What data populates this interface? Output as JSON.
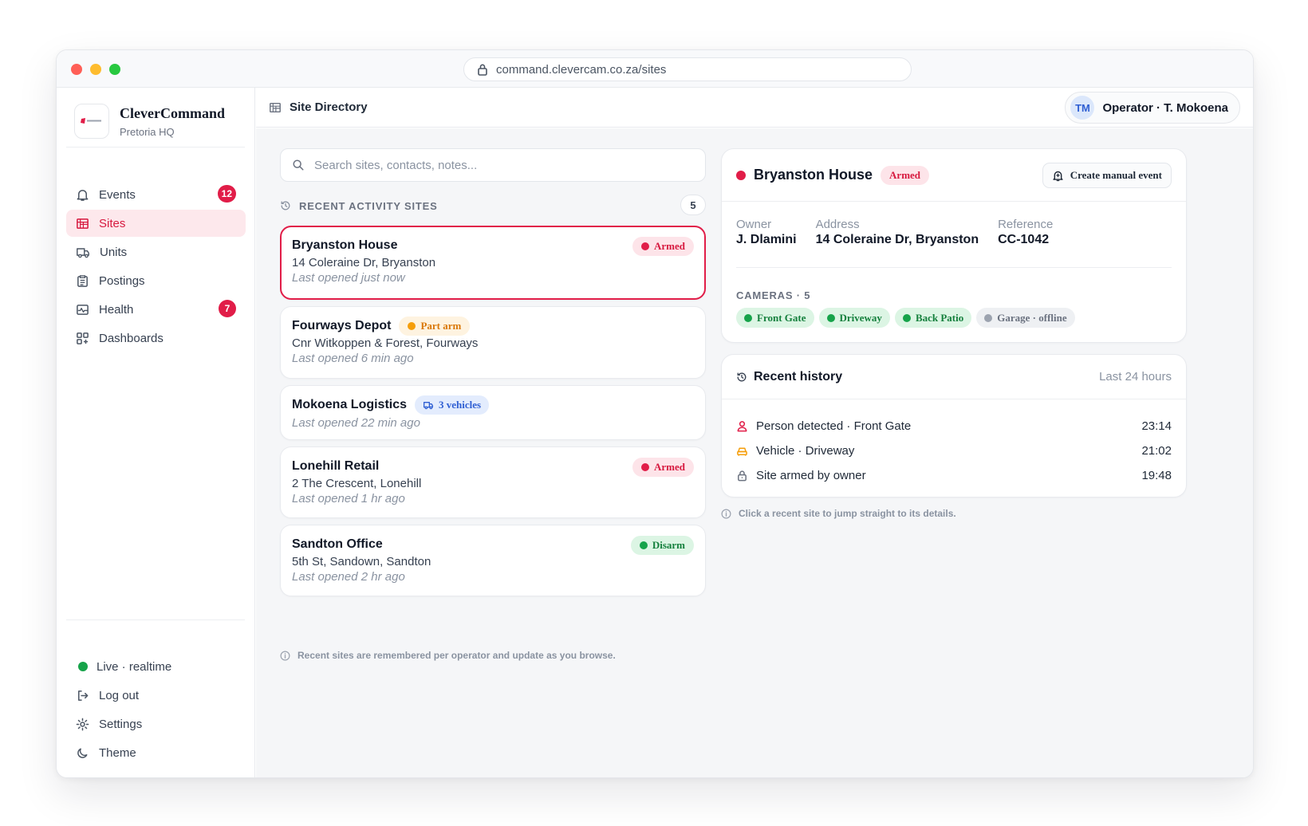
{
  "browser": {
    "url": "command.clevercam.co.za/sites"
  },
  "brand": {
    "name": "CleverCommand",
    "location": "Pretoria HQ"
  },
  "nav": {
    "items": [
      {
        "label": "Events",
        "icon": "bell-icon",
        "badge": "12"
      },
      {
        "label": "Sites",
        "icon": "building-icon",
        "active": true
      },
      {
        "label": "Units",
        "icon": "truck-icon"
      },
      {
        "label": "Postings",
        "icon": "clipboard-icon"
      },
      {
        "label": "Health",
        "icon": "pulse-icon",
        "badge": "7"
      },
      {
        "label": "Dashboards",
        "icon": "grid-icon"
      }
    ],
    "bottom": [
      {
        "label": "Live · realtime",
        "icon": "live-dot"
      },
      {
        "label": "Log out",
        "icon": "logout-icon"
      },
      {
        "label": "Settings",
        "icon": "gear-icon"
      },
      {
        "label": "Theme",
        "icon": "moon-icon"
      }
    ]
  },
  "topbar": {
    "title": "Site Directory",
    "operator_initials": "TM",
    "operator_label": "Operator · T. Mokoena"
  },
  "search": {
    "placeholder": "Search sites, contacts, notes..."
  },
  "recent": {
    "heading": "RECENT ACTIVITY SITES",
    "count": "5",
    "sites": [
      {
        "name": "Bryanston House",
        "address": "14 Coleraine Dr, Bryanston",
        "last": "Last opened just now",
        "status": "Armed",
        "status_kind": "armed"
      },
      {
        "name": "Fourways Depot",
        "address": "Cnr Witkoppen & Forest, Fourways",
        "last": "Last opened 6 min ago",
        "status": "Part arm",
        "status_kind": "part"
      },
      {
        "name": "Mokoena Logistics",
        "address": "",
        "last": "Last opened 22 min ago",
        "status": "3 vehicles",
        "status_kind": "vehicles"
      },
      {
        "name": "Lonehill Retail",
        "address": "2 The Crescent, Lonehill",
        "last": "Last opened 1 hr ago",
        "status": "Armed",
        "status_kind": "armed"
      },
      {
        "name": "Sandton Office",
        "address": "5th St, Sandown, Sandton",
        "last": "Last opened 2 hr ago",
        "status": "Disarm",
        "status_kind": "disarm"
      }
    ],
    "note": "Recent sites are remembered per operator and update as you browse."
  },
  "detail": {
    "name": "Bryanston House",
    "status": "Armed",
    "create_button": "Create manual event",
    "owner_label": "Owner",
    "owner": "J. Dlamini",
    "address_label": "Address",
    "address": "14 Coleraine Dr, Bryanston",
    "reference_label": "Reference",
    "reference": "CC-1042",
    "cameras_heading": "CAMERAS · 5",
    "cameras": [
      {
        "label": "Front Gate",
        "online": true
      },
      {
        "label": "Driveway",
        "online": true
      },
      {
        "label": "Back Patio",
        "online": true
      },
      {
        "label": "Garage · offline",
        "online": false
      }
    ]
  },
  "history": {
    "title": "Recent history",
    "range": "Last 24 hours",
    "items": [
      {
        "icon": "person-icon",
        "text": "Person detected · Front Gate",
        "time": "23:14"
      },
      {
        "icon": "car-icon",
        "text": "Vehicle · Driveway",
        "time": "21:02"
      },
      {
        "icon": "lock-icon",
        "text": "Site armed by owner",
        "time": "19:48"
      }
    ]
  },
  "hint": "Click a recent site to jump straight to its details.",
  "colors": {
    "accent": "#e11d48",
    "armed": "#e11d48",
    "part_arm": "#f59e0b",
    "disarm": "#16a34a",
    "vehicles": "#2f5fd3",
    "offline": "#9ca3af"
  }
}
